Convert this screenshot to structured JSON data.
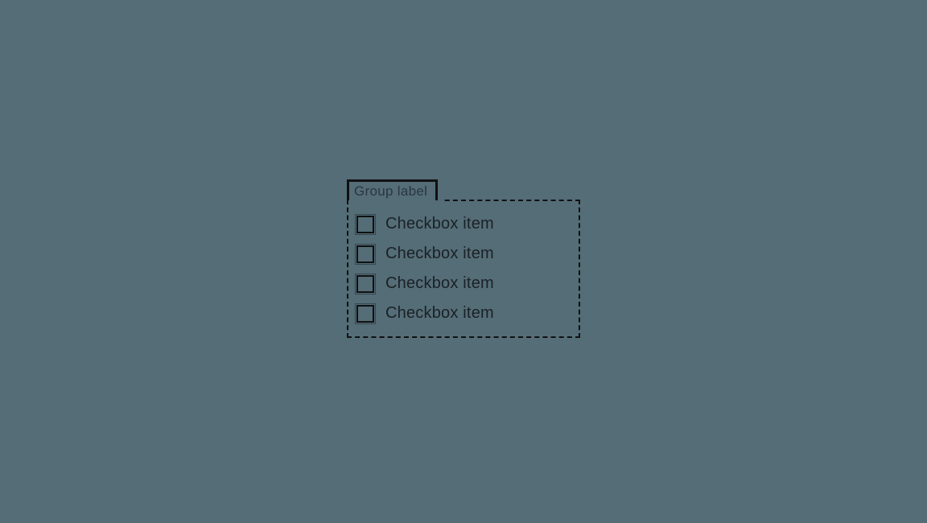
{
  "group": {
    "label": "Group label",
    "items": [
      {
        "label": "Checkbox item",
        "checked": false
      },
      {
        "label": "Checkbox item",
        "checked": false
      },
      {
        "label": "Checkbox item",
        "checked": false
      },
      {
        "label": "Checkbox item",
        "checked": false
      }
    ]
  }
}
